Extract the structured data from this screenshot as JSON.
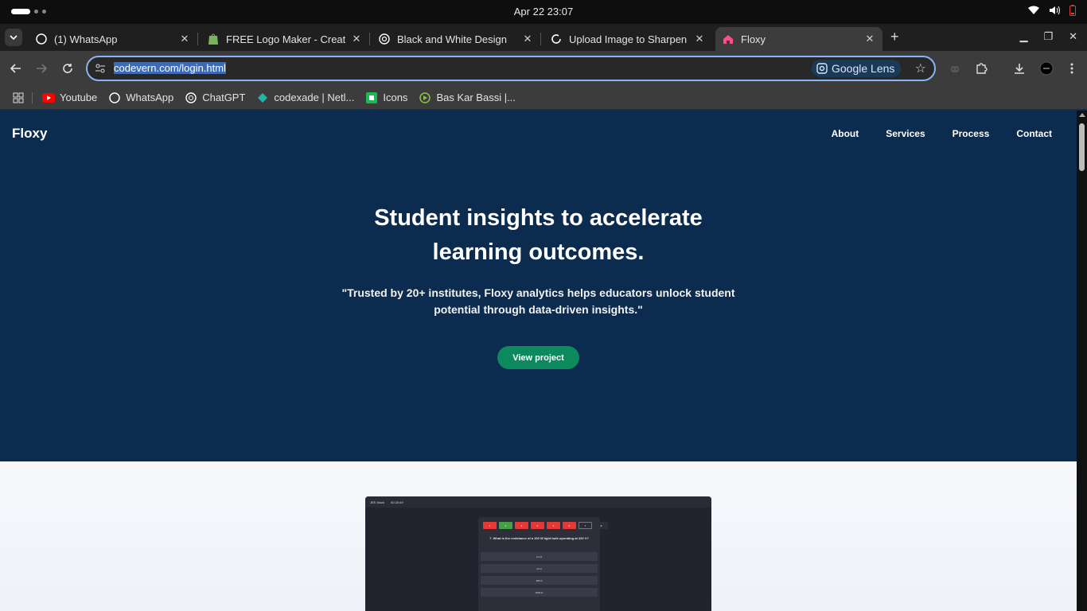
{
  "system": {
    "clock": "Apr 22  23:07"
  },
  "tabs": [
    {
      "title": "(1) WhatsApp",
      "icon": "whatsapp-icon"
    },
    {
      "title": "FREE Logo Maker - Create",
      "icon": "shopify-icon"
    },
    {
      "title": "Black and White Design",
      "icon": "chatgpt-icon"
    },
    {
      "title": "Upload Image to Sharpen",
      "icon": "loading-icon"
    },
    {
      "title": "Floxy",
      "icon": "floxy-icon",
      "active": true
    }
  ],
  "address_bar": {
    "url": "codevern.com/login.html",
    "lens_label": "Google Lens"
  },
  "bookmarks": [
    {
      "label": "Youtube",
      "icon": "youtube-icon"
    },
    {
      "label": "WhatsApp",
      "icon": "whatsapp-icon"
    },
    {
      "label": "ChatGPT",
      "icon": "chatgpt-icon"
    },
    {
      "label": "codexade | Netl...",
      "icon": "netlify-icon"
    },
    {
      "label": "Icons",
      "icon": "icons-icon"
    },
    {
      "label": "Bas Kar Bassi |...",
      "icon": "play-icon"
    }
  ],
  "site": {
    "brand": "Floxy",
    "nav": [
      "About",
      "Services",
      "Process",
      "Contact"
    ],
    "headline_line1": "Student insights to accelerate",
    "headline_line2": "learning outcomes.",
    "subtitle": "\"Trusted by 20+ institutes, Floxy analytics helps educators unlock student potential through data-driven insights.\"",
    "cta": "View project"
  },
  "mockup": {
    "header_left": "JEE Mock",
    "header_right": "00:20:49",
    "question_numbers": [
      "1",
      "2",
      "3",
      "4",
      "5",
      "6",
      "7",
      "8"
    ],
    "question": "7. What is the resistance of a 100 W light bulb operating at 220 V?",
    "options": [
      "2.2 Ω",
      "22 Ω",
      "484 Ω",
      "1000 Ω"
    ]
  },
  "colors": {
    "hero_bg": "#0b2b4f",
    "cta_bg": "#0c8a5e",
    "chrome_bg": "#3c3c3c"
  }
}
